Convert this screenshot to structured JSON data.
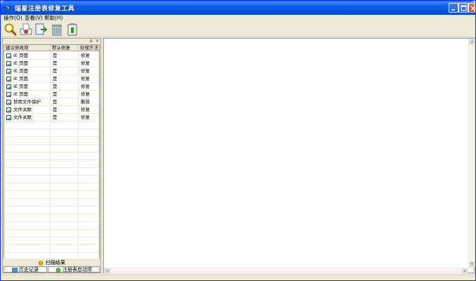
{
  "window": {
    "title": "瑞星注册表修复工具",
    "icon": "app-logo-icon",
    "controls": [
      "minimize-icon",
      "maximize-icon",
      "close-icon"
    ]
  },
  "menu": [
    {
      "label": "操作(O)"
    },
    {
      "label": "查看(V)"
    },
    {
      "label": "帮助(H)"
    }
  ],
  "toolbar": [
    {
      "icon": "scan-magnifier-icon"
    },
    {
      "icon": "repair-icon"
    },
    {
      "icon": "export-icon"
    },
    {
      "icon": "delete-trash-icon"
    },
    {
      "icon": "backup-icon"
    }
  ],
  "panel": {
    "pin_icon": "pin-icon",
    "close_icon": "close-icon",
    "columns": [
      "建议修改项",
      "默认修复",
      "处理方法"
    ],
    "rows": [
      {
        "checked": true,
        "item": "IE 页面",
        "default": "是",
        "method": "修复"
      },
      {
        "checked": true,
        "item": "IE 页面",
        "default": "是",
        "method": "修复"
      },
      {
        "checked": true,
        "item": "IE 页面",
        "default": "是",
        "method": "修复"
      },
      {
        "checked": true,
        "item": "IE 页面",
        "default": "是",
        "method": "修复"
      },
      {
        "checked": true,
        "item": "IE 页面",
        "default": "是",
        "method": "修复"
      },
      {
        "checked": true,
        "item": "IE 页面",
        "default": "是",
        "method": "修复"
      },
      {
        "checked": true,
        "item": "禁用文件保护",
        "default": "是",
        "method": "删除"
      },
      {
        "checked": true,
        "item": "文件关联",
        "default": "是",
        "method": "修复"
      },
      {
        "checked": true,
        "item": "文件关联",
        "default": "是",
        "method": "修复"
      }
    ],
    "tabs": {
      "active": {
        "label": "扫描结果",
        "icon": "scan-result-icon"
      },
      "history": {
        "label": "历史记录",
        "icon": "history-icon"
      },
      "startup": {
        "label": "注册表启动项",
        "icon": "startup-icon"
      }
    }
  },
  "colors": {
    "titlebar": "#0a5ce6",
    "face": "#ece9d8",
    "checkmark": "#21a121"
  }
}
